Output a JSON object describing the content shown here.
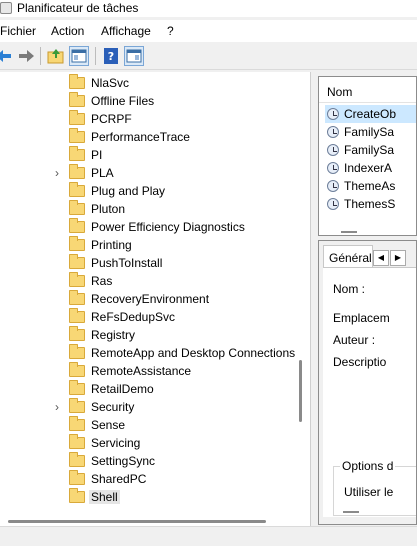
{
  "window": {
    "title": "Planificateur de tâches"
  },
  "menu": [
    "Fichier",
    "Action",
    "Affichage",
    "?"
  ],
  "tree": {
    "items": [
      {
        "label": "NlaSvc",
        "expandable": false
      },
      {
        "label": "Offline Files",
        "expandable": false
      },
      {
        "label": "PCRPF",
        "expandable": false
      },
      {
        "label": "PerformanceTrace",
        "expandable": false
      },
      {
        "label": "PI",
        "expandable": false
      },
      {
        "label": "PLA",
        "expandable": true
      },
      {
        "label": "Plug and Play",
        "expandable": false
      },
      {
        "label": "Pluton",
        "expandable": false
      },
      {
        "label": "Power Efficiency Diagnostics",
        "expandable": false
      },
      {
        "label": "Printing",
        "expandable": false
      },
      {
        "label": "PushToInstall",
        "expandable": false
      },
      {
        "label": "Ras",
        "expandable": false
      },
      {
        "label": "RecoveryEnvironment",
        "expandable": false
      },
      {
        "label": "ReFsDedupSvc",
        "expandable": false
      },
      {
        "label": "Registry",
        "expandable": false
      },
      {
        "label": "RemoteApp and Desktop Connections",
        "expandable": false
      },
      {
        "label": "RemoteAssistance",
        "expandable": false
      },
      {
        "label": "RetailDemo",
        "expandable": false
      },
      {
        "label": "Security",
        "expandable": true
      },
      {
        "label": "Sense",
        "expandable": false
      },
      {
        "label": "Servicing",
        "expandable": false
      },
      {
        "label": "SettingSync",
        "expandable": false
      },
      {
        "label": "SharedPC",
        "expandable": false
      },
      {
        "label": "Shell",
        "expandable": false,
        "selected": true
      }
    ]
  },
  "task_list": {
    "column_header": "Nom",
    "rows": [
      "CreateOb",
      "FamilySa",
      "FamilySa",
      "IndexerA",
      "ThemeAs",
      "ThemesS"
    ]
  },
  "details": {
    "tab_label": "Général",
    "fields": [
      "Nom :",
      "Emplacem",
      "Auteur :",
      "Descriptio"
    ],
    "group_legend": "Options d",
    "group_text": "Utiliser le"
  },
  "colors": {
    "selection": "#cce8ff",
    "folder": "#f8d775",
    "tree_selection": "#e5e5e5"
  }
}
